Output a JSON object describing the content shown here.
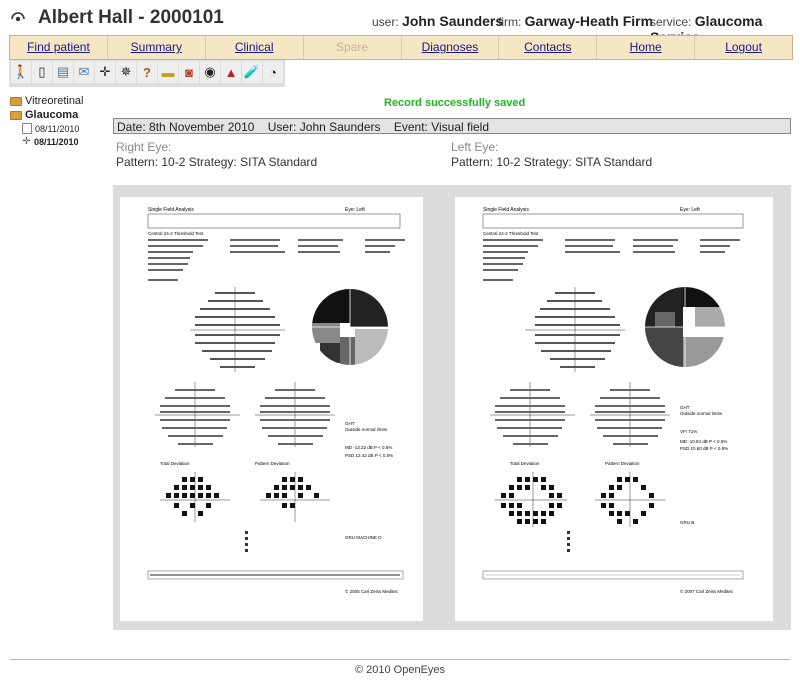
{
  "header": {
    "patient_title": "Albert Hall - 2000101",
    "user_label": "user:",
    "user_name": "John Saunders",
    "firm_label": "firm:",
    "firm_name": "Garway-Heath Firm",
    "service_label": "service:",
    "service_name": "Glaucoma Service"
  },
  "nav": {
    "find_patient": "Find patient",
    "summary": "Summary",
    "clinical": "Clinical",
    "spare": "Spare",
    "diagnoses": "Diagnoses",
    "contacts": "Contacts",
    "home": "Home",
    "logout": "Logout"
  },
  "toolbar_icons": [
    "person-icon",
    "document-icon",
    "card-icon",
    "envelope-icon",
    "crosshair-icon",
    "bug-icon",
    "question-icon",
    "ruler-icon",
    "camera-icon",
    "eye-scan-icon",
    "warning-icon",
    "test-tube-icon",
    "openeyes-icon"
  ],
  "sidebar": {
    "specialty_1": "Vitreoretinal",
    "specialty_2": "Glaucoma",
    "event_date_1": "08/11/2010",
    "event_date_2": "08/11/2010"
  },
  "status": {
    "message": "Record successfully saved"
  },
  "event": {
    "date": "Date: 8th November 2010",
    "user": "User: John Saunders",
    "type": "Event: Visual field"
  },
  "right_eye": {
    "label": "Right Eye:",
    "pattern": "Pattern: 10-2 Strategy: SITA Standard",
    "report": {
      "title": "Single Field Analysis",
      "eye": "Eye: Left",
      "test": "Central 24-2 Threshold Test",
      "md": "MD   -13.22 dB  P < 0.5%",
      "psd": "PSD   12.42 dB  P < 0.5%",
      "ght": "GHT",
      "ght_result": "Outside normal limits",
      "total_dev": "Total Deviation",
      "pattern_dev": "Pattern Deviation",
      "machine": "GRU MACHINE D",
      "copyright": "© 2005 Carl Zeiss Meditec"
    }
  },
  "left_eye": {
    "label": "Left Eye:",
    "pattern": "Pattern: 10-2 Strategy: SITA Standard",
    "report": {
      "title": "Single Field Analysis",
      "eye": "Eye: Left",
      "test": "Central 24-2 Threshold Test",
      "vfi": "VFI   71%",
      "md": "MD   -10.84 dB  P < 0.5%",
      "psd": "PSD   10.60 dB  P < 0.5%",
      "ght": "GHT",
      "ght_result": "Outside normal limits",
      "total_dev": "Total Deviation",
      "pattern_dev": "Pattern Deviation",
      "machine": "GRU B",
      "copyright": "© 2007 Carl Zeiss Meditec"
    }
  },
  "footer": {
    "copyright": "© 2010 OpenEyes"
  }
}
